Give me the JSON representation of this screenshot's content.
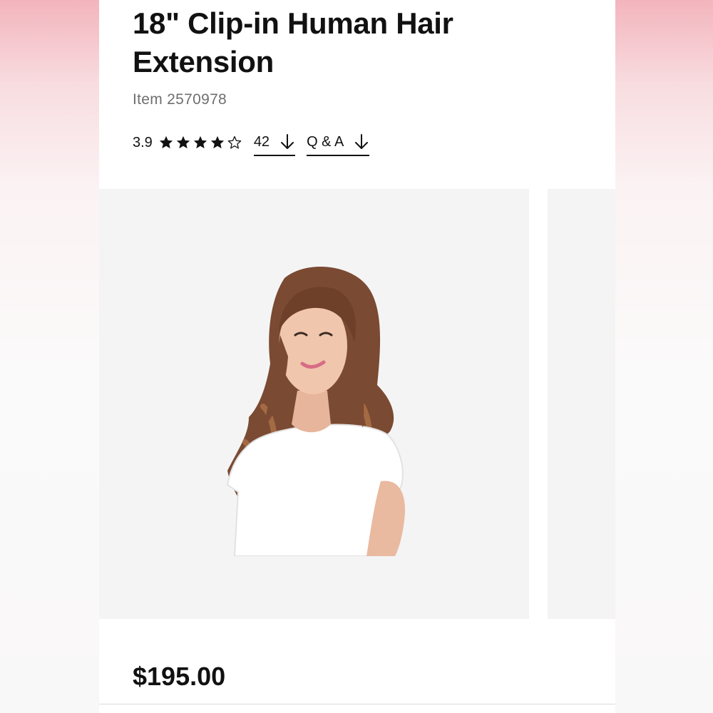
{
  "product": {
    "title": "18\" Clip-in Human Hair Extension",
    "item_number": "Item 2570978",
    "rating": {
      "value": "3.9",
      "stars_filled": 4,
      "stars_total": 5
    },
    "reviews_count": "42",
    "qa_label": "Q & A",
    "price": "$195.00"
  },
  "icons": {
    "star": "star-icon",
    "reviews_arrow": "arrow-down-icon",
    "qa_arrow": "arrow-down-icon"
  },
  "colors": {
    "background_top": "#f3b4bd",
    "text": "#111111",
    "muted_text": "#6f6f6f",
    "image_bg": "#f4f4f4",
    "hair": "#7a4a32",
    "shirt": "#ffffff"
  }
}
